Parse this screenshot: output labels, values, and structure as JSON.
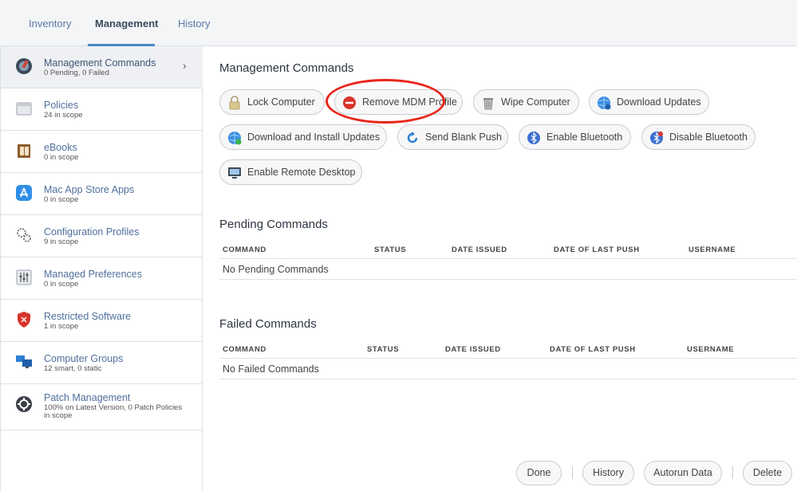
{
  "tabs": [
    {
      "label": "Inventory"
    },
    {
      "label": "Management"
    },
    {
      "label": "History"
    }
  ],
  "sidebar": {
    "items": [
      {
        "title": "Management Commands",
        "sub": "0 Pending, 0 Failed",
        "icon": "mdm-icon"
      },
      {
        "title": "Policies",
        "sub": "24 in scope",
        "icon": "policies-icon"
      },
      {
        "title": "eBooks",
        "sub": "0 in scope",
        "icon": "ebooks-icon"
      },
      {
        "title": "Mac App Store Apps",
        "sub": "0 in scope",
        "icon": "app-store-icon"
      },
      {
        "title": "Configuration Profiles",
        "sub": "9 in scope",
        "icon": "gears-icon"
      },
      {
        "title": "Managed Preferences",
        "sub": "0 in scope",
        "icon": "sliders-icon"
      },
      {
        "title": "Restricted Software",
        "sub": "1 in scope",
        "icon": "shield-icon"
      },
      {
        "title": "Computer Groups",
        "sub": "12 smart, 0 static",
        "icon": "computer-groups-icon"
      },
      {
        "title": "Patch Management",
        "sub": "100% on Latest Version, 0 Patch Policies",
        "sub2": "in scope",
        "icon": "patch-icon"
      }
    ]
  },
  "main": {
    "title": "Management Commands",
    "commands": [
      {
        "label": "Lock Computer",
        "icon": "lock-icon"
      },
      {
        "label": "Remove MDM Profile",
        "icon": "remove-icon"
      },
      {
        "label": "Wipe Computer",
        "icon": "trash-icon"
      },
      {
        "label": "Download Updates",
        "icon": "globe-download-icon"
      },
      {
        "label": "Download and Install Updates",
        "icon": "globe-install-icon"
      },
      {
        "label": "Send Blank Push",
        "icon": "refresh-icon"
      },
      {
        "label": "Enable Bluetooth",
        "icon": "bluetooth-icon"
      },
      {
        "label": "Disable Bluetooth",
        "icon": "bluetooth-disabled-icon"
      },
      {
        "label": "Enable Remote Desktop",
        "icon": "remote-desktop-icon"
      }
    ],
    "pending": {
      "title": "Pending Commands",
      "columns": [
        "COMMAND",
        "STATUS",
        "DATE ISSUED",
        "DATE OF LAST PUSH",
        "USERNAME"
      ],
      "empty": "No Pending Commands"
    },
    "failed": {
      "title": "Failed Commands",
      "columns": [
        "COMMAND",
        "STATUS",
        "DATE ISSUED",
        "DATE OF LAST PUSH",
        "USERNAME"
      ],
      "empty": "No Failed Commands"
    }
  },
  "footer": {
    "done": "Done",
    "history": "History",
    "autorun": "Autorun Data",
    "delete": "Delete"
  },
  "colors": {
    "accent": "#4c89c9",
    "annotation": "#e8271b",
    "link": "#4f6f9b"
  }
}
